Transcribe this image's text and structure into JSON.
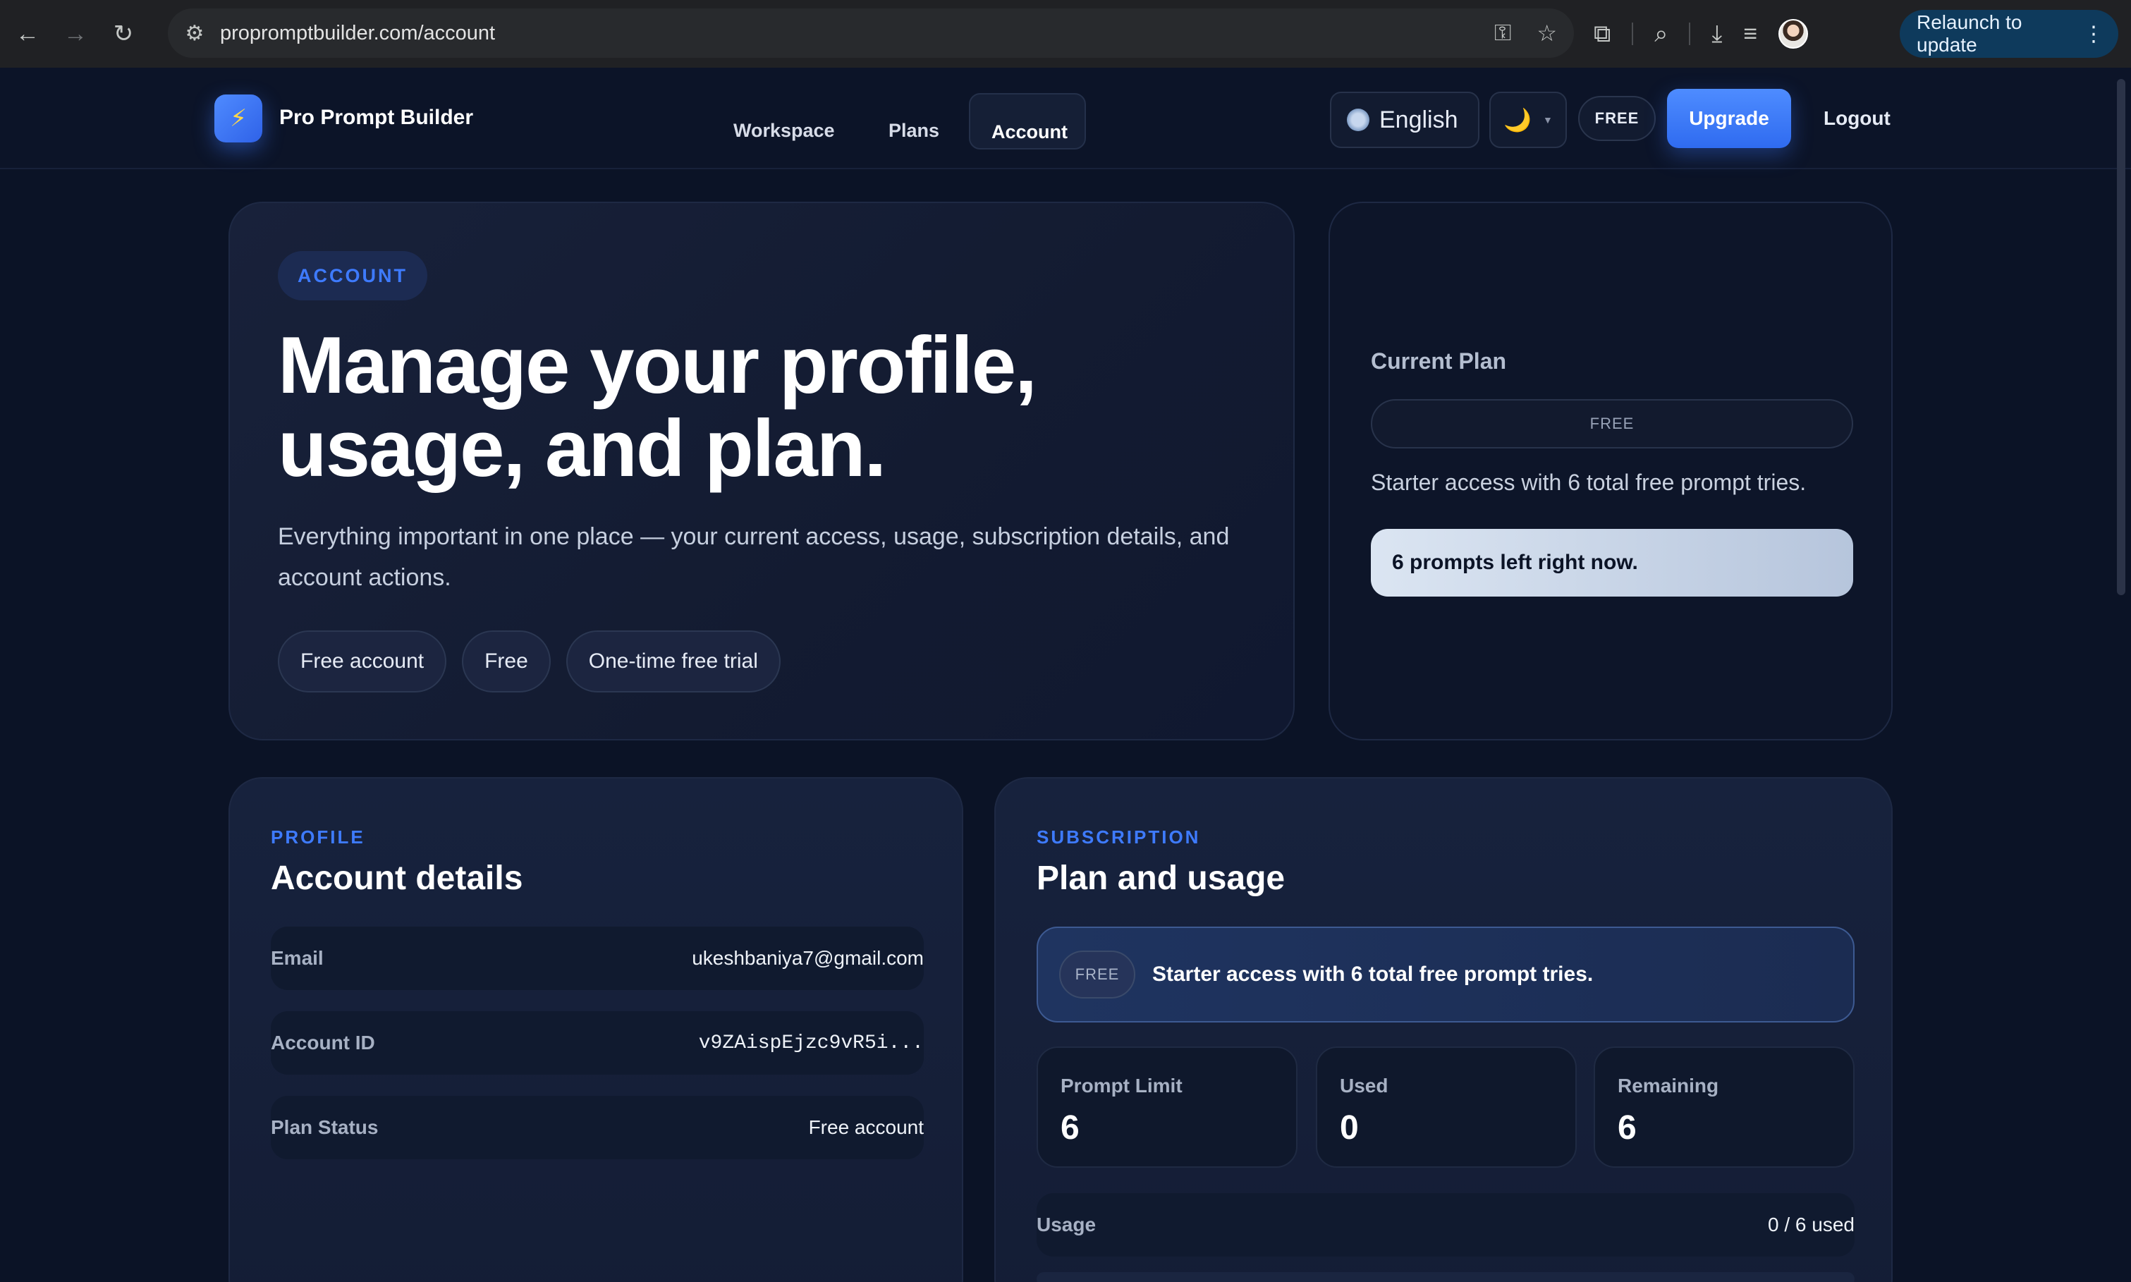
{
  "browser": {
    "url": "propromptbuilder.com/account",
    "relaunch_label": "Relaunch to update"
  },
  "header": {
    "brand": "Pro Prompt Builder",
    "logo_glyph": "⚡",
    "nav": [
      "Workspace",
      "Plans",
      "Account"
    ],
    "active_nav": "Account",
    "language": "English",
    "theme_glyph": "🌙",
    "plan_badge": "FREE",
    "upgrade_label": "Upgrade",
    "logout_label": "Logout"
  },
  "hero": {
    "eyebrow": "ACCOUNT",
    "title": "Manage your profile, usage, and plan.",
    "description": "Everything important in one place — your current access, usage, subscription details, and account actions.",
    "chips": [
      "Free account",
      "Free",
      "One-time free trial"
    ]
  },
  "current_plan": {
    "label": "Current Plan",
    "plan": "FREE",
    "description": "Starter access with 6 total free prompt tries.",
    "remaining_text": "6 prompts left right now."
  },
  "profile": {
    "eyebrow": "PROFILE",
    "title": "Account details",
    "rows": [
      {
        "label": "Email",
        "value": "ukeshbaniya7@gmail.com"
      },
      {
        "label": "Account ID",
        "value": "v9ZAispEjzc9vR5i..."
      },
      {
        "label": "Plan Status",
        "value": "Free account"
      }
    ]
  },
  "subscription": {
    "eyebrow": "SUBSCRIPTION",
    "title": "Plan and usage",
    "banner_badge": "FREE",
    "banner_text": "Starter access with 6 total free prompt tries.",
    "stats": [
      {
        "label": "Prompt Limit",
        "value": "6"
      },
      {
        "label": "Used",
        "value": "0"
      },
      {
        "label": "Remaining",
        "value": "6"
      }
    ],
    "usage_label": "Usage",
    "usage_value": "0 / 6 used",
    "usage_fraction": 0
  },
  "colors": {
    "accent": "#3e7bff",
    "background": "#0b1326"
  }
}
